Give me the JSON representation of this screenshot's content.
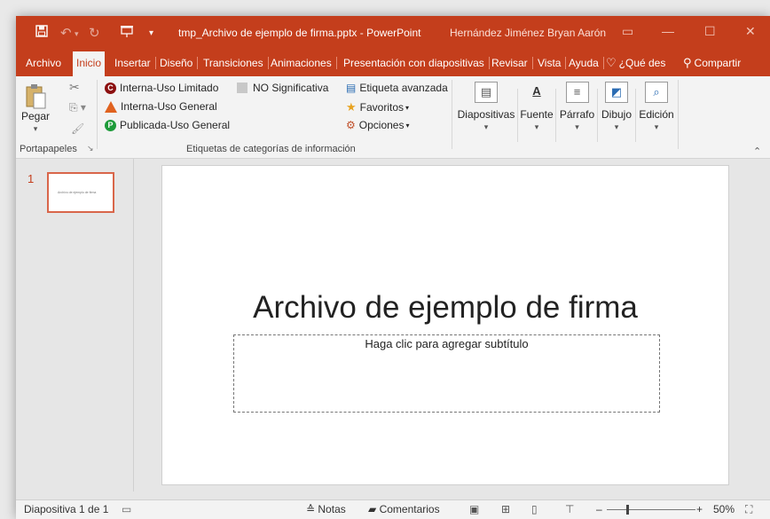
{
  "titlebar": {
    "filename": "tmp_Archivo de ejemplo de firma.pptx",
    "separator": " - ",
    "app": "PowerPoint",
    "user": "Hernández Jiménez Bryan Aarón"
  },
  "tabs": [
    {
      "label": "Archivo"
    },
    {
      "label": "Inicio"
    },
    {
      "label": "Insertar"
    },
    {
      "label": "Diseño"
    },
    {
      "label": "Transiciones"
    },
    {
      "label": "Animaciones"
    },
    {
      "label": "Presentación con diapositivas"
    },
    {
      "label": "Revisar"
    },
    {
      "label": "Vista"
    },
    {
      "label": "Ayuda"
    },
    {
      "label": "¿Qué des"
    },
    {
      "label": "Compartir"
    }
  ],
  "ribbon": {
    "clipboard": {
      "paste_label": "Pegar",
      "group_label": "Portapapeles"
    },
    "labels": {
      "interna_limitado": "Interna-Uso Limitado",
      "interna_general": "Interna-Uso General",
      "publicada_general": "Publicada-Uso General",
      "no_significativa": "NO Significativa",
      "etiqueta_avanzada": "Etiqueta avanzada",
      "favoritos": "Favoritos",
      "opciones": "Opciones",
      "group_label": "Etiquetas de categorías de información"
    },
    "buttons": {
      "diapositivas": "Diapositivas",
      "fuente": "Fuente",
      "parrafo": "Párrafo",
      "dibujo": "Dibujo",
      "edicion": "Edición"
    },
    "badges": {
      "c": "C",
      "p": "P"
    },
    "font_letter": "A"
  },
  "slides_pane": {
    "number": "1",
    "thumb_text": "Archivo de ejemplo de firma"
  },
  "slide": {
    "title": "Archivo de ejemplo de firma",
    "subtitle_placeholder": "Haga clic para agregar subtítulo"
  },
  "statusbar": {
    "slide_info": "Diapositiva 1 de 1",
    "notes": "Notas",
    "comments": "Comentarios",
    "zoom_minus": "–",
    "zoom_plus": "+",
    "zoom": "50%"
  },
  "colors": {
    "accent": "#c43e1c",
    "ribbon": "#f3f3f3",
    "workspace": "#e6e6e6"
  }
}
